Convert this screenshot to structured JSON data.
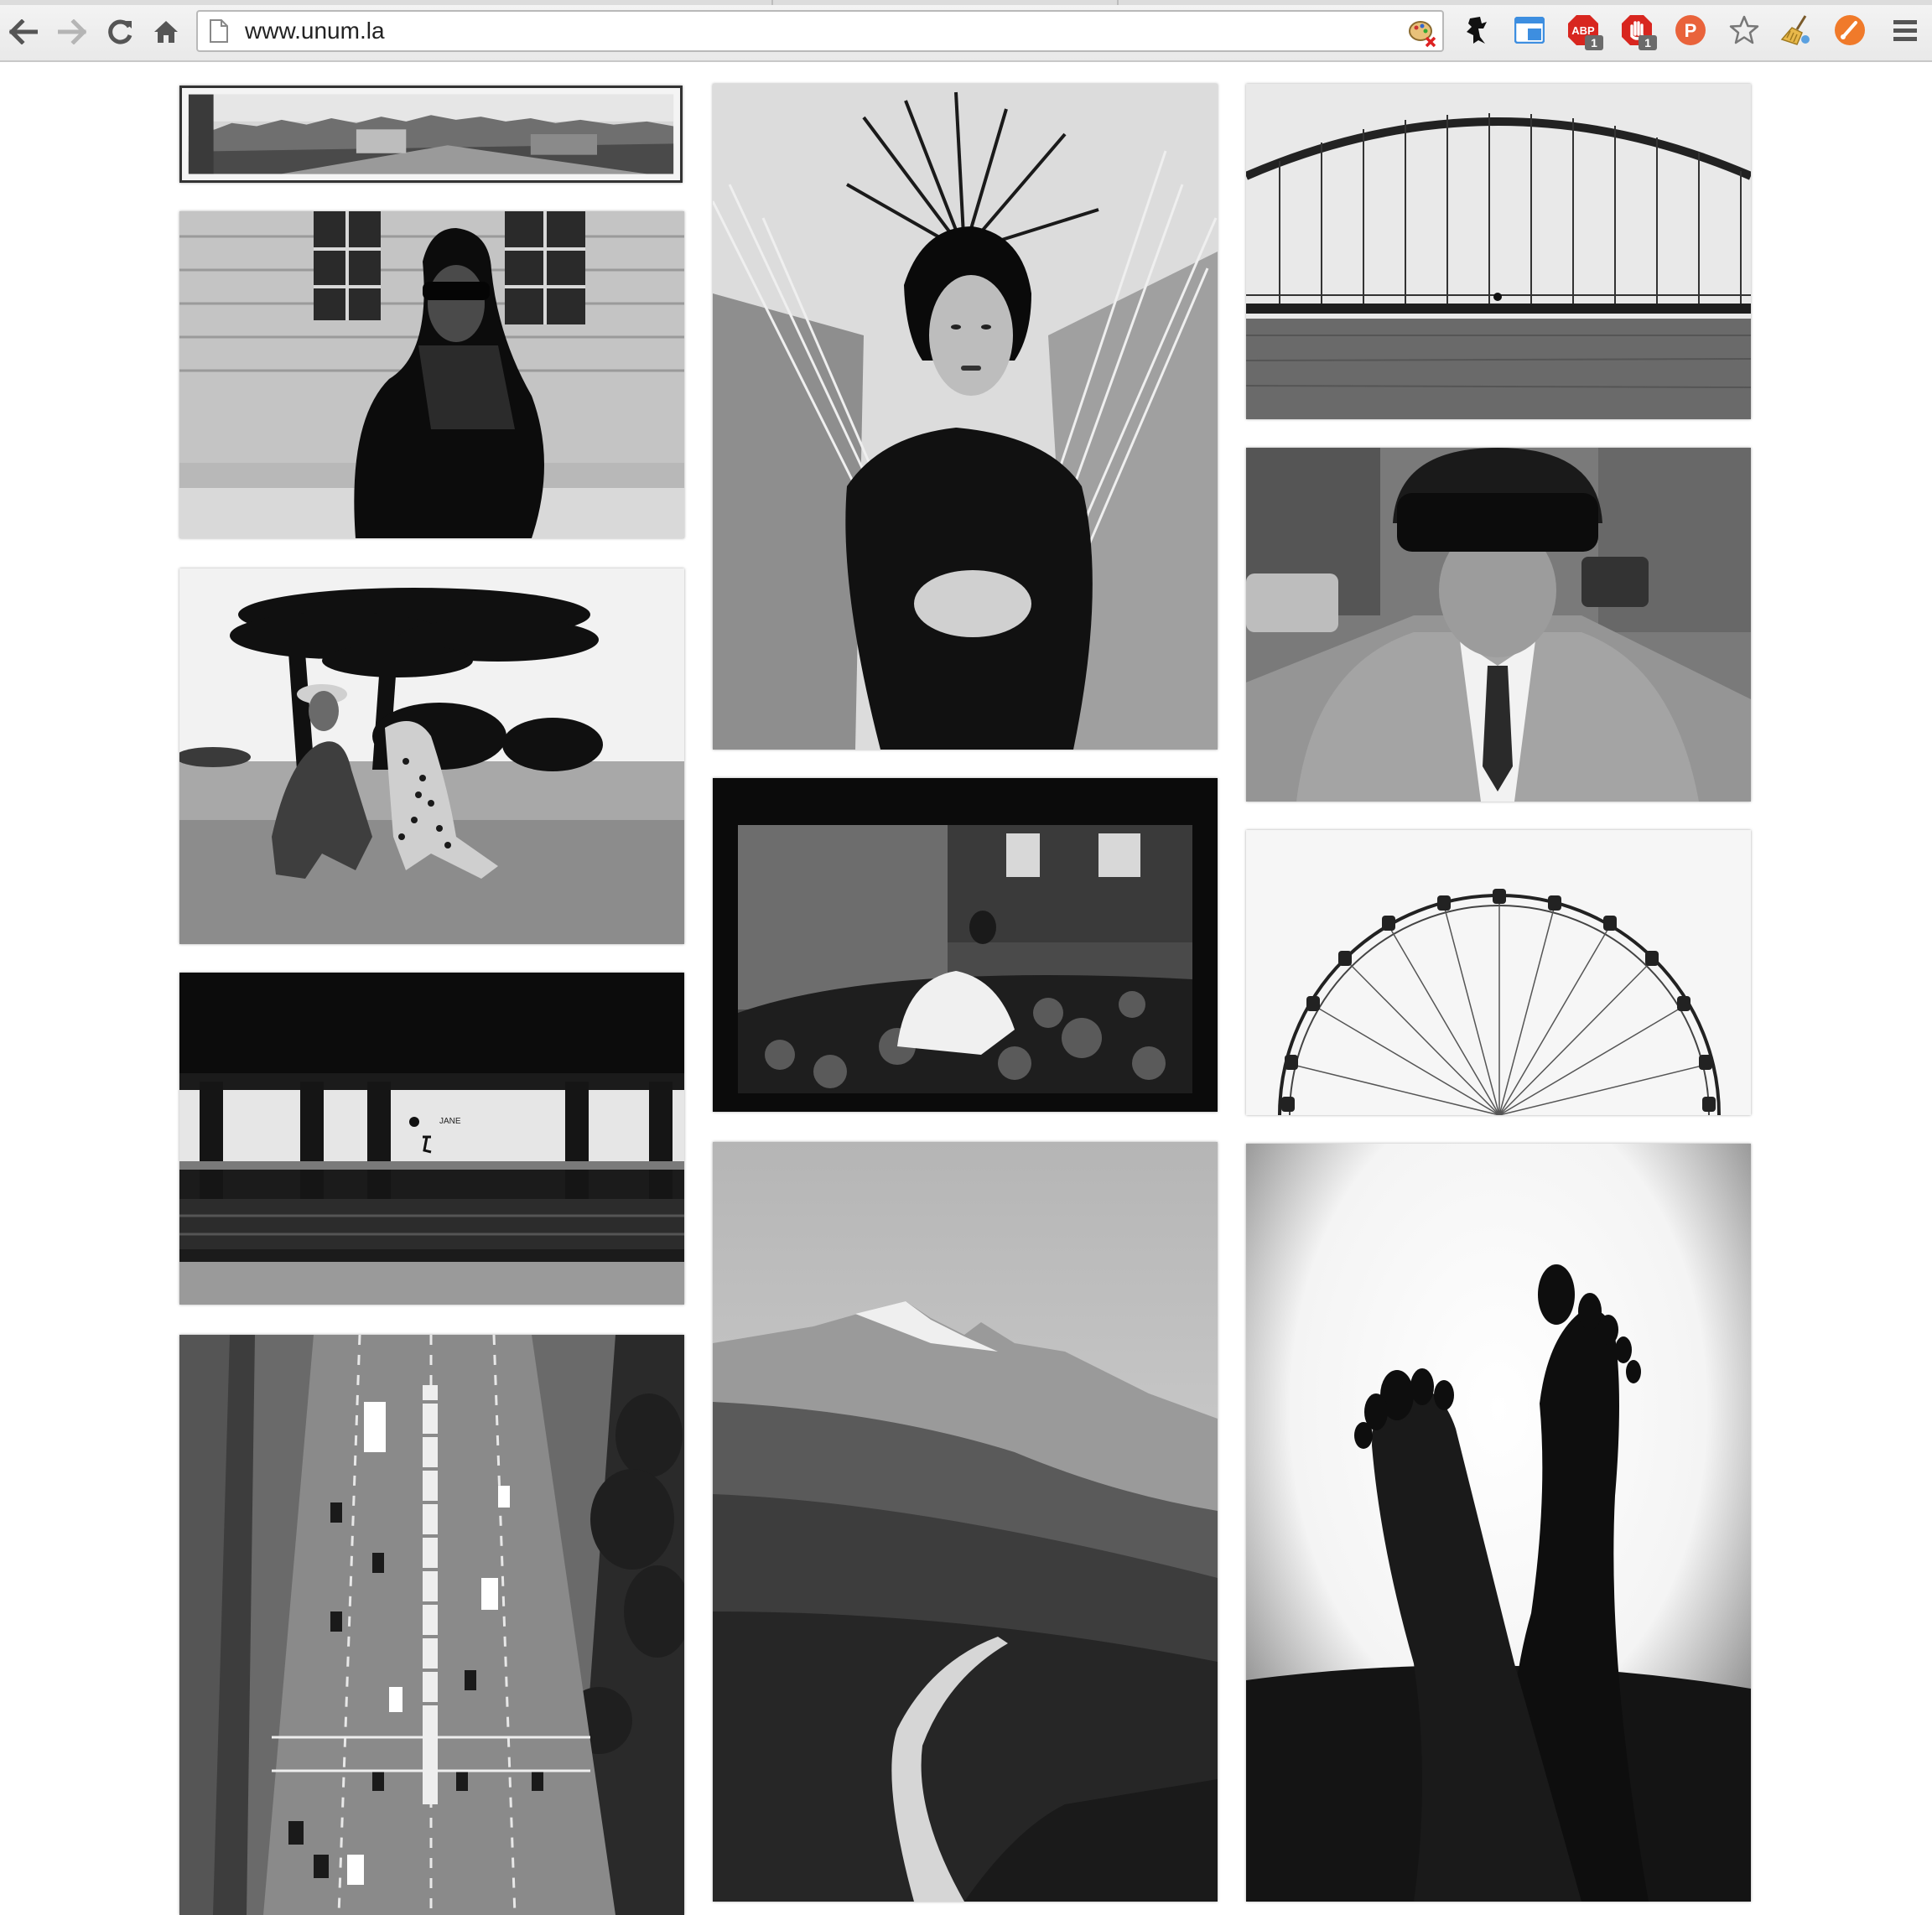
{
  "browser": {
    "url": "www.unum.la",
    "back_icon": "back-arrow-icon",
    "forward_icon": "forward-arrow-icon",
    "reload_icon": "reload-icon",
    "home_icon": "home-icon",
    "bookmark_icon": "star-icon",
    "menu_icon": "hamburger-menu-icon",
    "extensions": [
      {
        "name": "palette-blocked-extension",
        "badge": ""
      },
      {
        "name": "ninja-extension",
        "badge": ""
      },
      {
        "name": "window-extension",
        "badge": ""
      },
      {
        "name": "adblock-plus-extension",
        "label": "ABP",
        "badge": "1"
      },
      {
        "name": "adblock-hand-extension",
        "badge": "1"
      },
      {
        "name": "pocket-p-extension",
        "label": "P",
        "badge": ""
      },
      {
        "name": "broom-extension",
        "badge": ""
      },
      {
        "name": "orange-circle-extension",
        "badge": ""
      }
    ]
  },
  "gallery": {
    "style": "black-and-white photography masonry grid",
    "columns": [
      {
        "photos": [
          {
            "subject": "vintage city panorama"
          },
          {
            "subject": "woman in headscarf and sunglasses"
          },
          {
            "subject": "woman with cheetah under acacia tree"
          },
          {
            "subject": "subway platform with sign",
            "sign_text": "JANE"
          },
          {
            "subject": "aerial view of city street with traffic"
          }
        ]
      },
      {
        "photos": [
          {
            "subject": "woman holding palm fronds"
          },
          {
            "subject": "woman in field, film frame"
          },
          {
            "subject": "mountain path landscape"
          }
        ]
      },
      {
        "photos": [
          {
            "subject": "arched bridge over water"
          },
          {
            "subject": "man in suit with helmet on scooter"
          },
          {
            "subject": "ferris wheel"
          },
          {
            "subject": "feet silhouette"
          }
        ]
      }
    ]
  }
}
